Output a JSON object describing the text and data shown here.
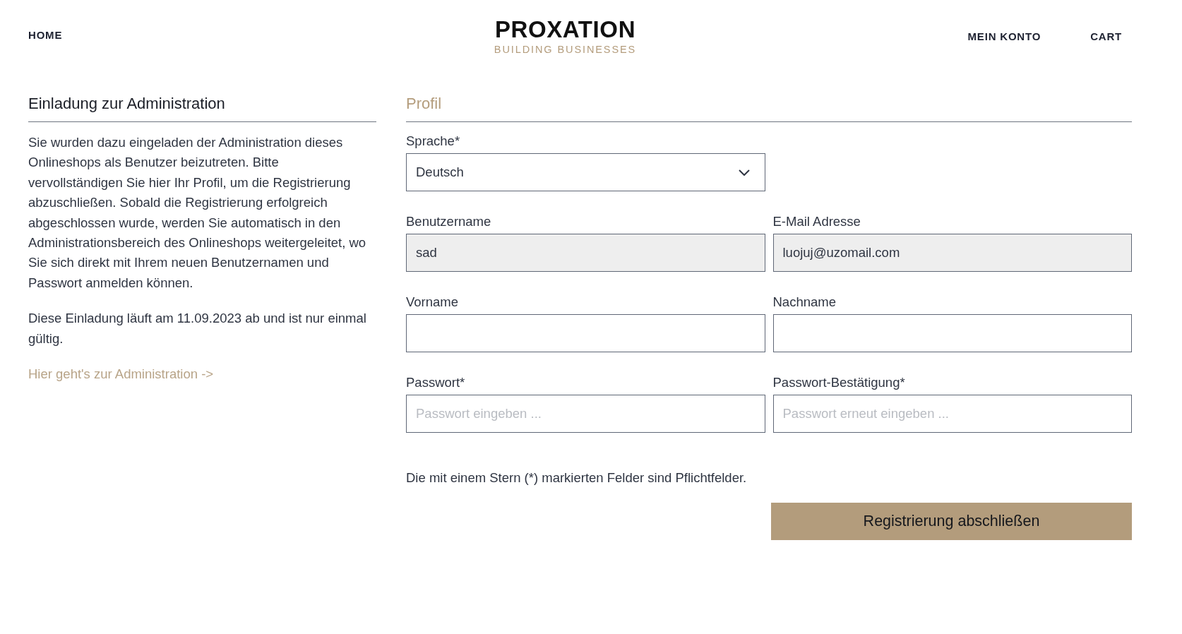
{
  "header": {
    "nav_left": [
      {
        "label": "HOME"
      }
    ],
    "logo": {
      "wordmark": "PROXATION",
      "tagline": "BUILDING BUSINESSES"
    },
    "nav_right": [
      {
        "label": "MEIN KONTO"
      },
      {
        "label": "CART"
      }
    ]
  },
  "invitation": {
    "title": "Einladung zur Administration",
    "paragraphs": [
      "Sie wurden dazu eingeladen der Administration dieses Onlineshops als Benutzer beizutreten. Bitte vervollständigen Sie hier Ihr Profil, um die Registrierung abzuschließen. Sobald die Registrierung erfolgreich abgeschlossen wurde, werden Sie automatisch in den Administrationsbereich des Onlineshops weitergeleitet, wo Sie sich direkt mit Ihrem neuen Benutzernamen und Passwort anmelden können.",
      "Diese Einladung läuft am 11.09.2023 ab und ist nur einmal gültig."
    ],
    "link": "Hier geht's zur Administration ->"
  },
  "profile": {
    "title": "Profil",
    "rows": [
      {
        "fields": [
          {
            "kind": "select",
            "label": "Sprache*",
            "value": "Deutsch",
            "readonly": false
          }
        ]
      },
      {
        "fields": [
          {
            "kind": "input",
            "label": "Benutzername",
            "value": "sad",
            "readonly": true
          },
          {
            "kind": "input",
            "label": "E-Mail Adresse",
            "value": "luojuj@uzomail.com",
            "readonly": true
          }
        ]
      },
      {
        "fields": [
          {
            "kind": "input",
            "label": "Vorname",
            "readonly": false
          },
          {
            "kind": "input",
            "label": "Nachname",
            "readonly": false
          }
        ]
      },
      {
        "fields": [
          {
            "kind": "input",
            "label": "Passwort*",
            "placeholder": "Passwort eingeben ...",
            "readonly": false
          },
          {
            "kind": "input",
            "label": "Passwort-Bestätigung*",
            "placeholder": "Passwort erneut eingeben ...",
            "readonly": false
          }
        ]
      }
    ],
    "note": "Die mit einem Stern (*) markierten Felder sind Pflichtfelder.",
    "submit_button": "Registrierung abschließen"
  }
}
